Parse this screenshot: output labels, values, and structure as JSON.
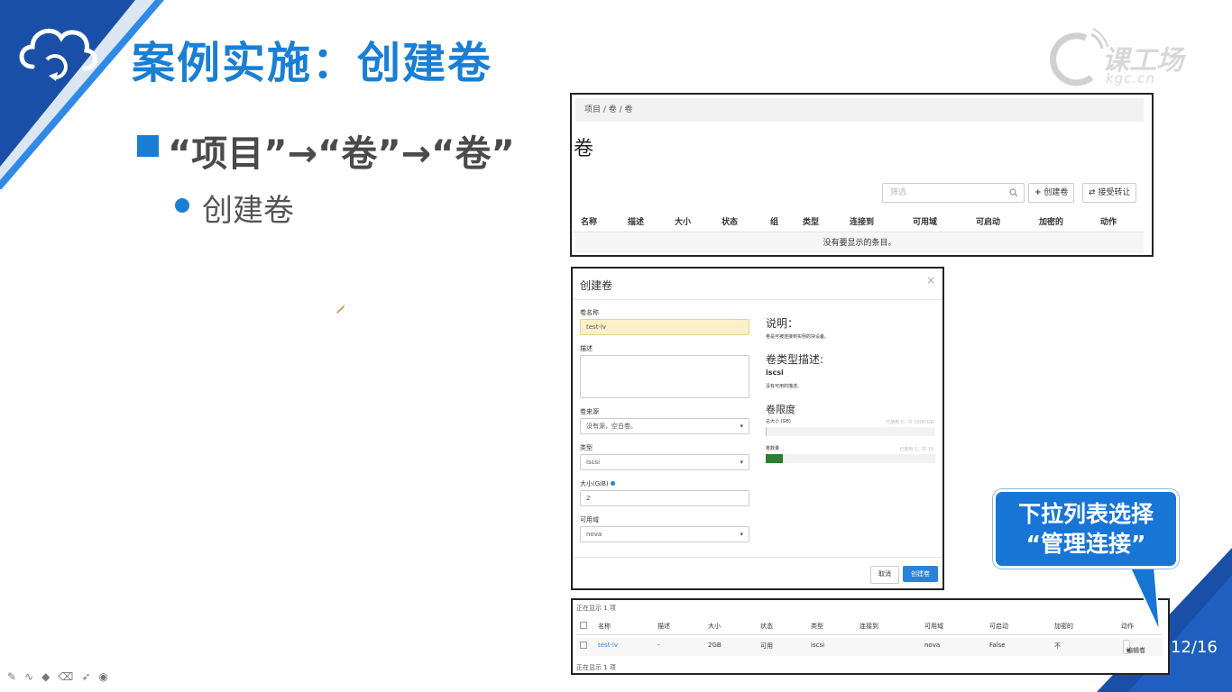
{
  "slide": {
    "title": "案例实施：创建卷",
    "bullet_main": "“项目”→“卷”→“卷”",
    "bullet_sub": "创建卷",
    "page_number": "12/16",
    "logo_text": "课工场",
    "logo_sub": "kgc.cn",
    "accent_color": "#1a7fd4"
  },
  "volumes_panel": {
    "breadcrumb": "项目 /  卷 /  卷",
    "heading": "卷",
    "filter_placeholder": "筛选",
    "create_button": "创建卷",
    "accept_transfer_button": "接受转让",
    "columns": [
      "名称",
      "描述",
      "大小",
      "状态",
      "组",
      "类型",
      "连接到",
      "可用域",
      "可启动",
      "加密的",
      "动作"
    ],
    "empty_message": "没有要显示的条目。"
  },
  "create_dialog": {
    "title": "创建卷",
    "close": "×",
    "name_label": "卷名称",
    "name_value": "test-lv",
    "desc_label": "描述",
    "source_label": "卷来源",
    "source_value": "没有源，空白卷。",
    "type_label": "类型",
    "type_value": "iscsi",
    "size_label": "大小(GiB)",
    "size_value": "2",
    "az_label": "可用域",
    "az_value": "nova",
    "help_heading": "说明：",
    "help_text": "卷是可被连接到实例的块设备。",
    "type_desc_heading": "卷类型描述:",
    "type_name": "iscsi",
    "type_desc": "没有可用的描述。",
    "limits_heading": "卷限度",
    "total_size_label": "总大小 (GB)",
    "total_size_meta": "已使用 0，共 1000 GB",
    "count_label": "卷数量",
    "count_meta": "已使用 1，共 10",
    "total_size_usage": 0.0,
    "count_usage": 0.1,
    "cancel_button": "取消",
    "create_button": "创建卷"
  },
  "result_panel": {
    "caption_top": "正在显示 1 项",
    "caption_bottom": "正在显示 1 项",
    "columns": [
      "名称",
      "描述",
      "大小",
      "状态",
      "类型",
      "连接到",
      "可用域",
      "可启动",
      "加密的",
      "动作"
    ],
    "row": {
      "name": "test-lv",
      "desc": "-",
      "size": "2GB",
      "status": "可用",
      "type": "iscsi",
      "attached": "",
      "az": "nova",
      "bootable": "False",
      "encrypted": "不",
      "action": "编辑卷"
    }
  },
  "callout": {
    "line1": "下拉列表选择",
    "line2": "“管理连接”"
  }
}
